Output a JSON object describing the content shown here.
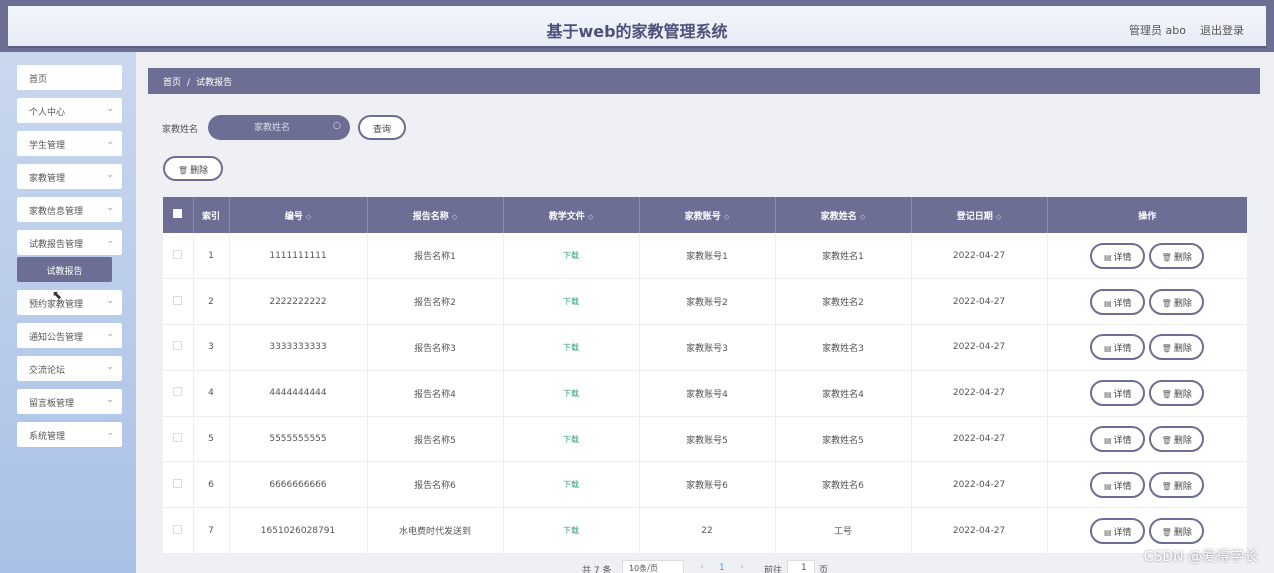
{
  "header": {
    "title": "基于web的家教管理系统",
    "admin": "管理员 abo",
    "logout": "退出登录"
  },
  "sidebar": {
    "items": [
      {
        "label": "首页"
      },
      {
        "label": "个人中心"
      },
      {
        "label": "学生管理"
      },
      {
        "label": "家教管理"
      },
      {
        "label": "家教信息管理"
      },
      {
        "label": "试教报告管理"
      },
      {
        "label": "预约家教管理"
      },
      {
        "label": "通知公告管理"
      },
      {
        "label": "交流论坛"
      },
      {
        "label": "留言板管理"
      },
      {
        "label": "系统管理"
      }
    ],
    "active_sub": "试教报告"
  },
  "breadcrumb": {
    "home": "首页",
    "separator": "/",
    "current": "试教报告"
  },
  "search": {
    "label": "家教姓名",
    "placeholder": "家教姓名",
    "button": "查询"
  },
  "toolbar": {
    "delete_label": "删除"
  },
  "table": {
    "headers": [
      "索引",
      "编号",
      "报告名称",
      "教学文件",
      "家教账号",
      "家教姓名",
      "登记日期",
      "操作"
    ],
    "rows": [
      {
        "index": "1",
        "code": "1111111111",
        "name": "报告名称1",
        "file": "下载",
        "account": "家教账号1",
        "tutor": "家教姓名1",
        "date": "2022-04-27"
      },
      {
        "index": "2",
        "code": "2222222222",
        "name": "报告名称2",
        "file": "下载",
        "account": "家教账号2",
        "tutor": "家教姓名2",
        "date": "2022-04-27"
      },
      {
        "index": "3",
        "code": "3333333333",
        "name": "报告名称3",
        "file": "下载",
        "account": "家教账号3",
        "tutor": "家教姓名3",
        "date": "2022-04-27"
      },
      {
        "index": "4",
        "code": "4444444444",
        "name": "报告名称4",
        "file": "下载",
        "account": "家教账号4",
        "tutor": "家教姓名4",
        "date": "2022-04-27"
      },
      {
        "index": "5",
        "code": "5555555555",
        "name": "报告名称5",
        "file": "下载",
        "account": "家教账号5",
        "tutor": "家教姓名5",
        "date": "2022-04-27"
      },
      {
        "index": "6",
        "code": "6666666666",
        "name": "报告名称6",
        "file": "下载",
        "account": "家教账号6",
        "tutor": "家教姓名6",
        "date": "2022-04-27"
      },
      {
        "index": "7",
        "code": "1651026028791",
        "name": "水电费时代发送到",
        "file": "下载",
        "account": "22",
        "tutor": "工号",
        "date": "2022-04-27"
      }
    ],
    "actions": {
      "detail": "详情",
      "delete": "删除"
    }
  },
  "pagination": {
    "total": "共 7 条",
    "page_size": "10条/页",
    "current_page": "1",
    "goto_label": "前往",
    "goto_value": "1",
    "page_unit": "页"
  },
  "watermark": "CSDN @爱得学长",
  "colors": {
    "primary": "#6d6e94",
    "download": "#2e9d7a"
  }
}
